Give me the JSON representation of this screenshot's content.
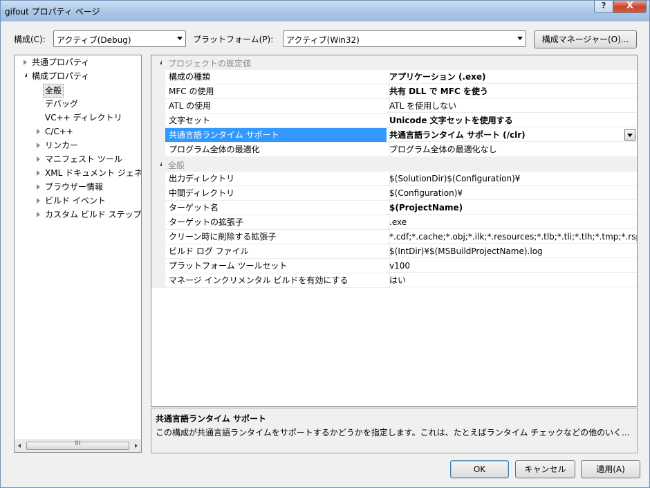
{
  "window": {
    "title": "gifout プロパティ ページ",
    "help": "?",
    "close": "X"
  },
  "toolbar": {
    "config_label": "構成(C):",
    "config_value": "アクティブ(Debug)",
    "platform_label": "プラットフォーム(P):",
    "platform_value": "アクティブ(Win32)",
    "config_manager": "構成マネージャー(O)..."
  },
  "tree": {
    "items": [
      {
        "label": "共通プロパティ"
      },
      {
        "label": "構成プロパティ"
      },
      {
        "label": "全般"
      },
      {
        "label": "デバッグ"
      },
      {
        "label": "VC++ ディレクトリ"
      },
      {
        "label": "C/C++"
      },
      {
        "label": "リンカー"
      },
      {
        "label": "マニフェスト ツール"
      },
      {
        "label": "XML ドキュメント ジェネ"
      },
      {
        "label": "ブラウザー情報"
      },
      {
        "label": "ビルド イベント"
      },
      {
        "label": "カスタム ビルド ステップ"
      }
    ],
    "scroll_grip": "III"
  },
  "grid": {
    "category1": "プロジェクトの既定値",
    "rows1": [
      {
        "name": "構成の種類",
        "value": "アプリケーション (.exe)"
      },
      {
        "name": "MFC の使用",
        "value": "共有 DLL で MFC を使う"
      },
      {
        "name": "ATL の使用",
        "value": "ATL を使用しない"
      },
      {
        "name": "文字セット",
        "value": "Unicode 文字セットを使用する"
      },
      {
        "name": "共通言語ランタイム サポート",
        "value": "共通言語ランタイム サポート (/clr)"
      },
      {
        "name": "プログラム全体の最適化",
        "value": "プログラム全体の最適化なし"
      }
    ],
    "category2": "全般",
    "rows2": [
      {
        "name": "出力ディレクトリ",
        "value": "$(SolutionDir)$(Configuration)¥"
      },
      {
        "name": "中間ディレクトリ",
        "value": "$(Configuration)¥"
      },
      {
        "name": "ターゲット名",
        "value": "$(ProjectName)"
      },
      {
        "name": "ターゲットの拡張子",
        "value": ".exe"
      },
      {
        "name": "クリーン時に削除する拡張子",
        "value": "*.cdf;*.cache;*.obj;*.ilk;*.resources;*.tlb;*.tli;*.tlh;*.tmp;*.rsp;*.pgc;*.pgd;*.meta;*.tlog;*.manifest;*.res"
      },
      {
        "name": "ビルド ログ ファイル",
        "value": "$(IntDir)¥$(MSBuildProjectName).log"
      },
      {
        "name": "プラットフォーム ツールセット",
        "value": "v100"
      },
      {
        "name": "マネージ インクリメンタル ビルドを有効にする",
        "value": "はい"
      }
    ]
  },
  "description": {
    "title": "共通言語ランタイム サポート",
    "text": "この構成が共通言語ランタイムをサポートするかどうかを指定します。これは、たとえばランタイム チェックなどの他のいく..."
  },
  "buttons": {
    "ok": "OK",
    "cancel": "キャンセル",
    "apply": "適用(A)"
  }
}
